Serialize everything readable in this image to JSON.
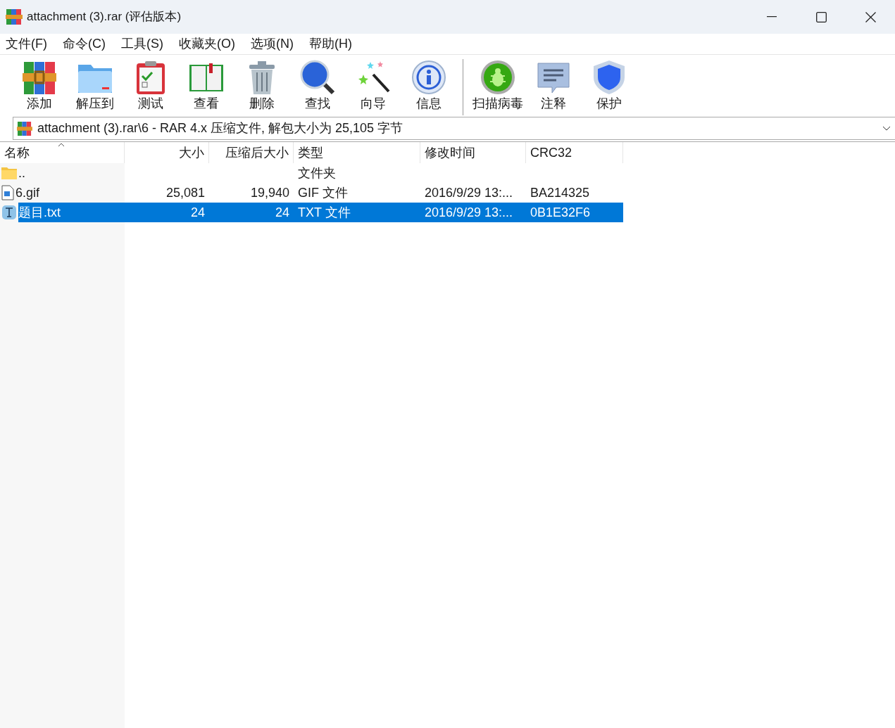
{
  "window": {
    "title": "attachment (3).rar (评估版本)"
  },
  "menu": [
    "文件(F)",
    "命令(C)",
    "工具(S)",
    "收藏夹(O)",
    "选项(N)",
    "帮助(H)"
  ],
  "toolbar": [
    {
      "kind": "add",
      "label": "添加"
    },
    {
      "kind": "extract",
      "label": "解压到"
    },
    {
      "kind": "test",
      "label": "测试"
    },
    {
      "kind": "view",
      "label": "查看"
    },
    {
      "kind": "delete",
      "label": "删除"
    },
    {
      "kind": "find",
      "label": "查找"
    },
    {
      "kind": "wizard",
      "label": "向导"
    },
    {
      "kind": "info",
      "label": "信息"
    },
    {
      "kind": "virus",
      "label": "扫描病毒"
    },
    {
      "kind": "comment",
      "label": "注释"
    },
    {
      "kind": "protect",
      "label": "保护"
    }
  ],
  "address": "attachment (3).rar\\6 - RAR 4.x 压缩文件, 解包大小为 25,105 字节",
  "table": {
    "columns": [
      "名称",
      "大小",
      "压缩后大小",
      "类型",
      "修改时间",
      "CRC32"
    ],
    "rows": [
      {
        "kind": "folder",
        "name": "..",
        "size": "",
        "packed": "",
        "type": "文件夹",
        "modified": "",
        "crc": "",
        "selected": false
      },
      {
        "kind": "image",
        "name": "6.gif",
        "size": "25,081",
        "packed": "19,940",
        "type": "GIF 文件",
        "modified": "2016/9/29 13:...",
        "crc": "BA214325",
        "selected": false
      },
      {
        "kind": "text",
        "name": "题目.txt",
        "size": "24",
        "packed": "24",
        "type": "TXT 文件",
        "modified": "2016/9/29 13:...",
        "crc": "0B1E32F6",
        "selected": true
      }
    ]
  }
}
